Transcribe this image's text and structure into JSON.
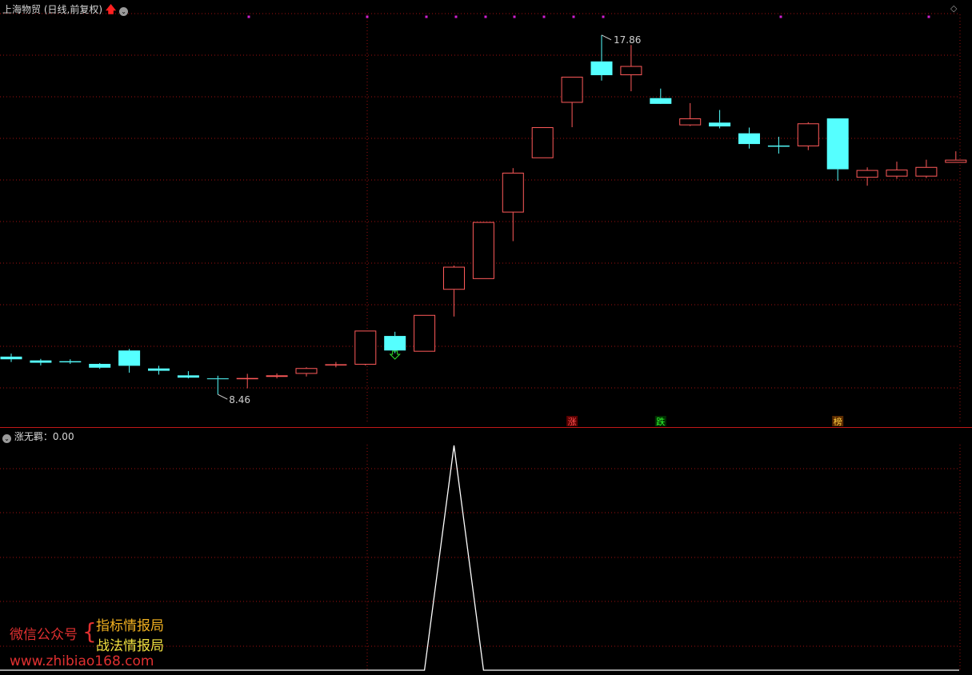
{
  "header": {
    "stock_name": "上海物贸",
    "period": "(日线,前复权)"
  },
  "indicator": {
    "name": "涨无羁",
    "value": "0.00"
  },
  "annotations": {
    "high_label": "17.86",
    "low_label": "8.46",
    "markers": [
      "涨",
      "跌",
      "榜"
    ]
  },
  "watermark": {
    "wechat_label": "微信公众号",
    "brace": "{",
    "line1": "指标情报局",
    "line2": "战法情报局",
    "url": "www.zhibiao168.com"
  },
  "colors": {
    "up": "#ff5a5a",
    "down": "#55ffff",
    "grid": "#a01010",
    "magenta": "#d020d0",
    "indicator_line": "#ffffff"
  },
  "chart_data": [
    {
      "type": "candlestick",
      "title": "上海物贸 (日线,前复权)",
      "ylim": [
        7.9,
        18.4
      ],
      "candles": [
        {
          "o": 9.45,
          "h": 9.53,
          "l": 9.31,
          "c": 9.38
        },
        {
          "o": 9.35,
          "h": 9.39,
          "l": 9.22,
          "c": 9.29
        },
        {
          "o": 9.33,
          "h": 9.38,
          "l": 9.26,
          "c": 9.3
        },
        {
          "o": 9.26,
          "h": 9.28,
          "l": 9.13,
          "c": 9.16
        },
        {
          "o": 9.61,
          "h": 9.65,
          "l": 9.03,
          "c": 9.21
        },
        {
          "o": 9.14,
          "h": 9.21,
          "l": 8.98,
          "c": 9.08
        },
        {
          "o": 8.96,
          "h": 9.07,
          "l": 8.88,
          "c": 8.9
        },
        {
          "o": 8.88,
          "h": 8.95,
          "l": 8.46,
          "c": 8.87
        },
        {
          "o": 8.87,
          "h": 9.0,
          "l": 8.62,
          "c": 8.89
        },
        {
          "o": 8.92,
          "h": 9.01,
          "l": 8.88,
          "c": 8.96
        },
        {
          "o": 9.0,
          "h": 9.17,
          "l": 8.93,
          "c": 9.15
        },
        {
          "o": 9.24,
          "h": 9.31,
          "l": 9.17,
          "c": 9.25
        },
        {
          "o": 9.24,
          "h": 10.13,
          "l": 9.22,
          "c": 10.13
        },
        {
          "o": 9.99,
          "h": 10.1,
          "l": 9.54,
          "c": 9.61
        },
        {
          "o": 9.58,
          "h": 10.54,
          "l": 9.58,
          "c": 10.54
        },
        {
          "o": 11.2,
          "h": 11.83,
          "l": 10.5,
          "c": 11.8
        },
        {
          "o": 11.48,
          "h": 12.97,
          "l": 11.48,
          "c": 12.97
        },
        {
          "o": 13.22,
          "h": 14.38,
          "l": 12.47,
          "c": 14.26
        },
        {
          "o": 14.64,
          "h": 15.45,
          "l": 14.64,
          "c": 15.45
        },
        {
          "o": 16.09,
          "h": 16.77,
          "l": 15.45,
          "c": 16.77
        },
        {
          "o": 17.17,
          "h": 17.86,
          "l": 16.67,
          "c": 16.81
        },
        {
          "o": 16.81,
          "h": 17.6,
          "l": 16.39,
          "c": 17.05
        },
        {
          "o": 16.21,
          "h": 16.46,
          "l": 16.08,
          "c": 16.06
        },
        {
          "o": 15.5,
          "h": 16.08,
          "l": 15.48,
          "c": 15.68
        },
        {
          "o": 15.57,
          "h": 15.9,
          "l": 15.42,
          "c": 15.47
        },
        {
          "o": 15.29,
          "h": 15.44,
          "l": 14.89,
          "c": 15.01
        },
        {
          "o": 14.97,
          "h": 15.2,
          "l": 14.76,
          "c": 14.94
        },
        {
          "o": 14.95,
          "h": 15.58,
          "l": 14.85,
          "c": 15.55
        },
        {
          "o": 15.68,
          "h": 15.68,
          "l": 14.05,
          "c": 14.35
        },
        {
          "o": 14.13,
          "h": 14.4,
          "l": 13.92,
          "c": 14.33
        },
        {
          "o": 14.16,
          "h": 14.55,
          "l": 14.1,
          "c": 14.34
        },
        {
          "o": 14.16,
          "h": 14.6,
          "l": 14.12,
          "c": 14.41
        },
        {
          "o": 14.52,
          "h": 14.82,
          "l": 14.52,
          "c": 14.6
        }
      ]
    },
    {
      "type": "line",
      "title": "涨无羁",
      "ylim": [
        0,
        1
      ],
      "x_index": [
        0,
        14,
        15,
        16,
        32
      ],
      "values": [
        0,
        0,
        1,
        0,
        0
      ]
    }
  ]
}
